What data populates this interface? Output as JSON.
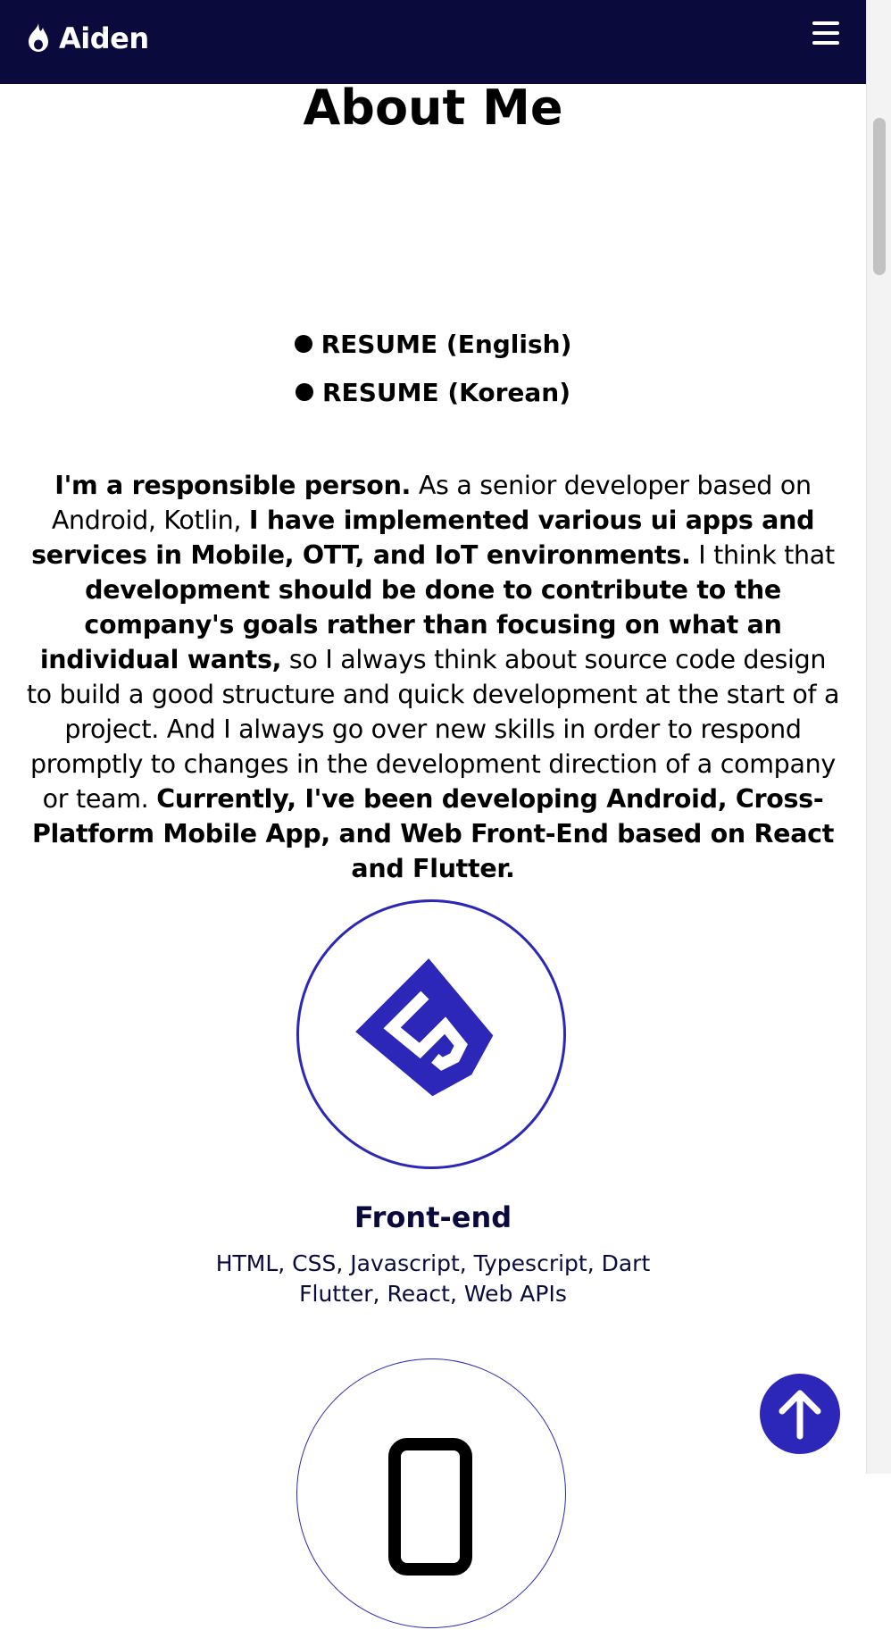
{
  "navbar": {
    "brand": "Aiden",
    "brand_icon": "fire-icon",
    "menu_icon": "hamburger-menu-icon"
  },
  "about": {
    "title": "About Me",
    "resume_links": [
      {
        "label": "RESUME (English)"
      },
      {
        "label": "RESUME (Korean)"
      }
    ],
    "intro": [
      {
        "text": "I'm a responsible person.",
        "bold": true
      },
      {
        "text": " As a senior developer based on Android, Kotlin, ",
        "bold": false
      },
      {
        "text": "I have implemented various ui apps and services in Mobile, OTT, and IoT environments.",
        "bold": true
      },
      {
        "text": " I think that ",
        "bold": false
      },
      {
        "text": "development should be done to contribute to the company's goals rather than focusing on what an individual wants,",
        "bold": true
      },
      {
        "text": " so I always think about source code design to build a good structure and quick development at the start of a project. And I always go over new skills in order to respond promptly to changes in the development direction of a company or team. ",
        "bold": false
      },
      {
        "text": "Currently, I've been developing Android, Cross-Platform Mobile App, and Web Front-End based on React and Flutter.",
        "bold": true
      }
    ]
  },
  "skills": [
    {
      "title": "Front-end",
      "icon": "html5-icon",
      "desc_line1": "HTML, CSS, Javascript, Typescript, Dart",
      "desc_line2": "Flutter, React, Web APIs"
    },
    {
      "icon": "mobile-phone-icon"
    }
  ],
  "colors": {
    "navbar_bg": "#0b0a3d",
    "accent": "#2c27b9",
    "skill_text": "#0b0a3d"
  },
  "back_to_top": {
    "icon": "arrow-up-icon"
  }
}
